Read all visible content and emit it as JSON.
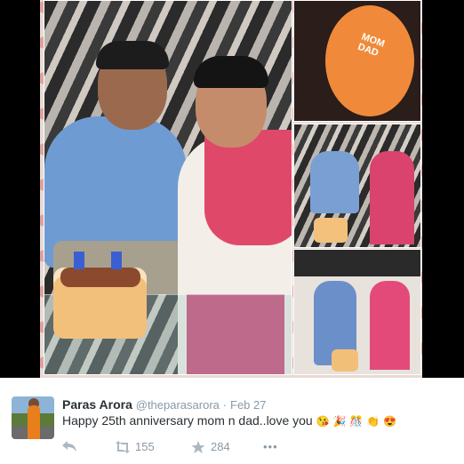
{
  "tweet": {
    "display_name": "Paras Arora",
    "handle": "@theparasarora",
    "separator": "·",
    "date": "Feb 27",
    "text": "Happy 25th anniversary mom n dad..love you",
    "emojis": [
      "😘",
      "🎉",
      "🎊",
      "👏",
      "😍"
    ],
    "retweet_count": "155",
    "favorite_count": "284",
    "more_label": "•••"
  },
  "collage": {
    "top_cake_text": "MOM DAD"
  },
  "icons": {
    "reply": "reply-icon",
    "retweet": "retweet-icon",
    "favorite": "star-icon",
    "more": "more-icon"
  },
  "colors": {
    "text": "#292f33",
    "muted": "#8899a6",
    "icon": "#aab8c2"
  }
}
